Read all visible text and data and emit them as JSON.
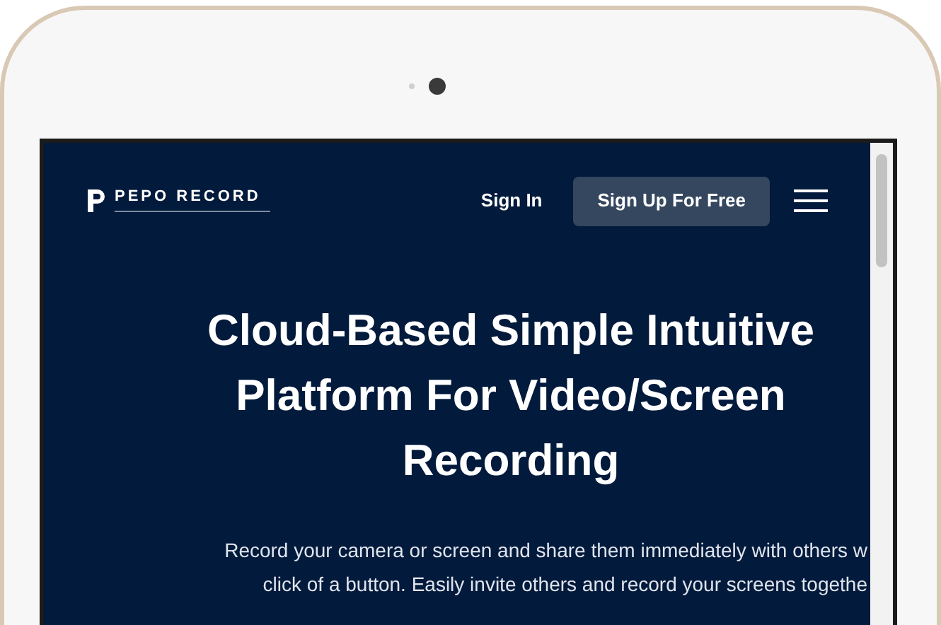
{
  "nav": {
    "logo": "PEPO RECORD",
    "sign_in": "Sign In",
    "sign_up": "Sign Up For Free"
  },
  "hero": {
    "heading_lines": [
      "Cloud-Based Simple Intuitive",
      "Platform For Video/Screen",
      "Recording"
    ],
    "paragraph_lines": [
      "Record your camera or screen and share them immediately with others w",
      "click of a button. Easily invite others and record your screens togethe"
    ]
  }
}
